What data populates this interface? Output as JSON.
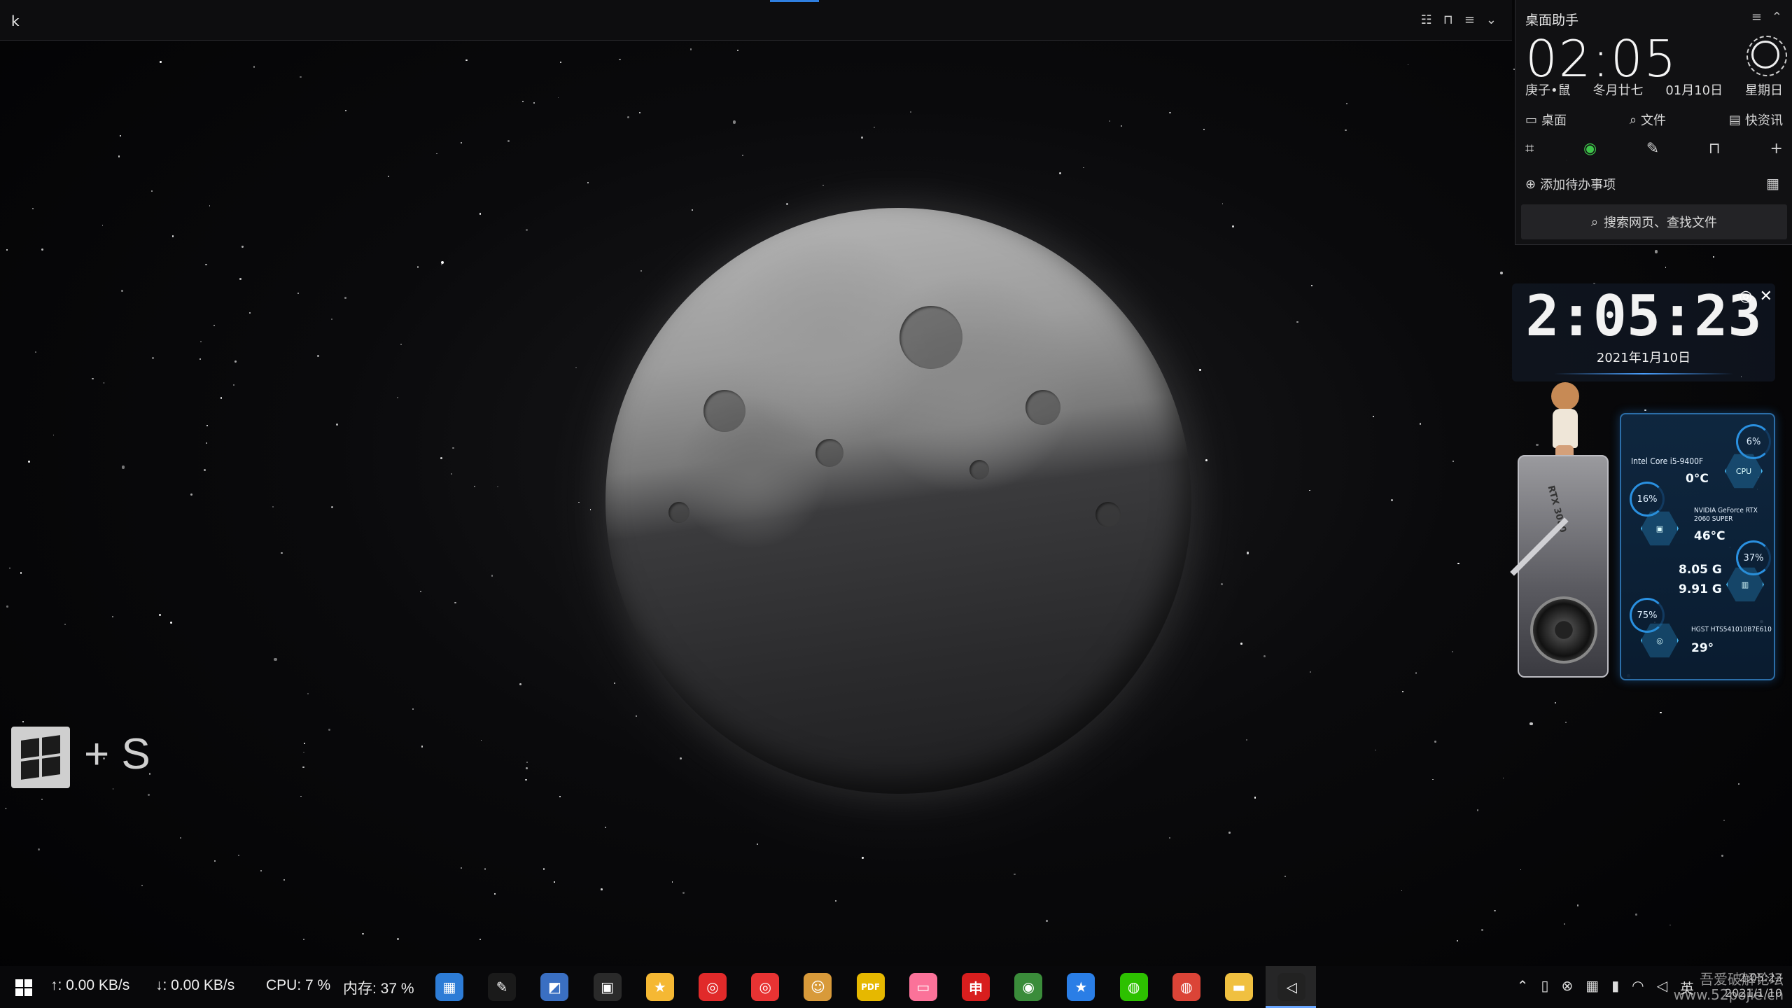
{
  "topbar": {
    "cursor_char": "k"
  },
  "assistant": {
    "title": "桌面助手",
    "time": "02:05",
    "lunar_year": "庚子•鼠",
    "lunar_date": "冬月廿七",
    "date": "01月10日",
    "weekday": "星期日",
    "nav": [
      {
        "label": "桌面",
        "icon": "monitor-icon"
      },
      {
        "label": "文件",
        "icon": "search-icon"
      },
      {
        "label": "快资讯",
        "icon": "news-icon"
      }
    ],
    "todo_label": "添加待办事项",
    "search_label": "搜索网页、查找文件"
  },
  "clock_widget": {
    "time": "2:05:23",
    "date": "2021年1月10日"
  },
  "hardware": {
    "gpu_card_label": "RTX 3080",
    "cpu": {
      "name": "Intel Core i5-9400F",
      "temp": "0°C",
      "usage": "6%",
      "hex_label": "CPU"
    },
    "gpu": {
      "name": "NVIDIA GeForce RTX 2060 SUPER",
      "temp": "46°C",
      "usage": "16%"
    },
    "memory": {
      "used": "8.05 G",
      "total": "9.91 G",
      "usage": "37%"
    },
    "disk": {
      "name": "HGST HTS541010B7E610",
      "temp": "29°",
      "usage": "75%"
    }
  },
  "hint": {
    "plus_s": "+ S"
  },
  "taskbar": {
    "upload": "↑: 0.00 KB/s",
    "download": "↓: 0.00 KB/s",
    "cpu": "CPU: 7 %",
    "memory": "内存: 37 %",
    "apps": [
      {
        "name": "store-icon",
        "color": "#2d7cd6",
        "glyph": "▦"
      },
      {
        "name": "feather-icon",
        "color": "#1a1a1a",
        "glyph": "✎"
      },
      {
        "name": "photo-app-icon",
        "color": "#3a6fc2",
        "glyph": "◩"
      },
      {
        "name": "radio-icon",
        "color": "#2a2a2a",
        "glyph": "▣"
      },
      {
        "name": "folder-yellow-icon",
        "color": "#f5b833",
        "glyph": "★"
      },
      {
        "name": "netease-music-icon",
        "color": "#e12a2a",
        "glyph": "◎"
      },
      {
        "name": "netease-music-2-icon",
        "color": "#e83333",
        "glyph": "◎"
      },
      {
        "name": "emoji-icon",
        "color": "#d89a3a",
        "glyph": "☺"
      },
      {
        "name": "pdf-icon",
        "color": "#e6b800",
        "glyph": "PDF"
      },
      {
        "name": "bilibili-icon",
        "color": "#fb7299",
        "glyph": "▭"
      },
      {
        "name": "chen-app-icon",
        "color": "#d81e1e",
        "glyph": "申"
      },
      {
        "name": "browser-globe-icon",
        "color": "#3a8c3a",
        "glyph": "◉"
      },
      {
        "name": "star-app-icon",
        "color": "#2a7ee6",
        "glyph": "★"
      },
      {
        "name": "wechat-icon",
        "color": "#2dc100",
        "glyph": "◍"
      },
      {
        "name": "chrome-icon",
        "color": "#db4437",
        "glyph": "◍"
      },
      {
        "name": "file-explorer-icon",
        "color": "#f0c040",
        "glyph": "▬"
      },
      {
        "name": "unity-icon",
        "color": "#222",
        "glyph": "◁"
      }
    ],
    "ime": "英",
    "clock_time": "2:05:23",
    "clock_date": "2021/1/10"
  },
  "watermark": {
    "line1": "吾爱破解论坛",
    "line2": "www.52pojie.cn"
  }
}
